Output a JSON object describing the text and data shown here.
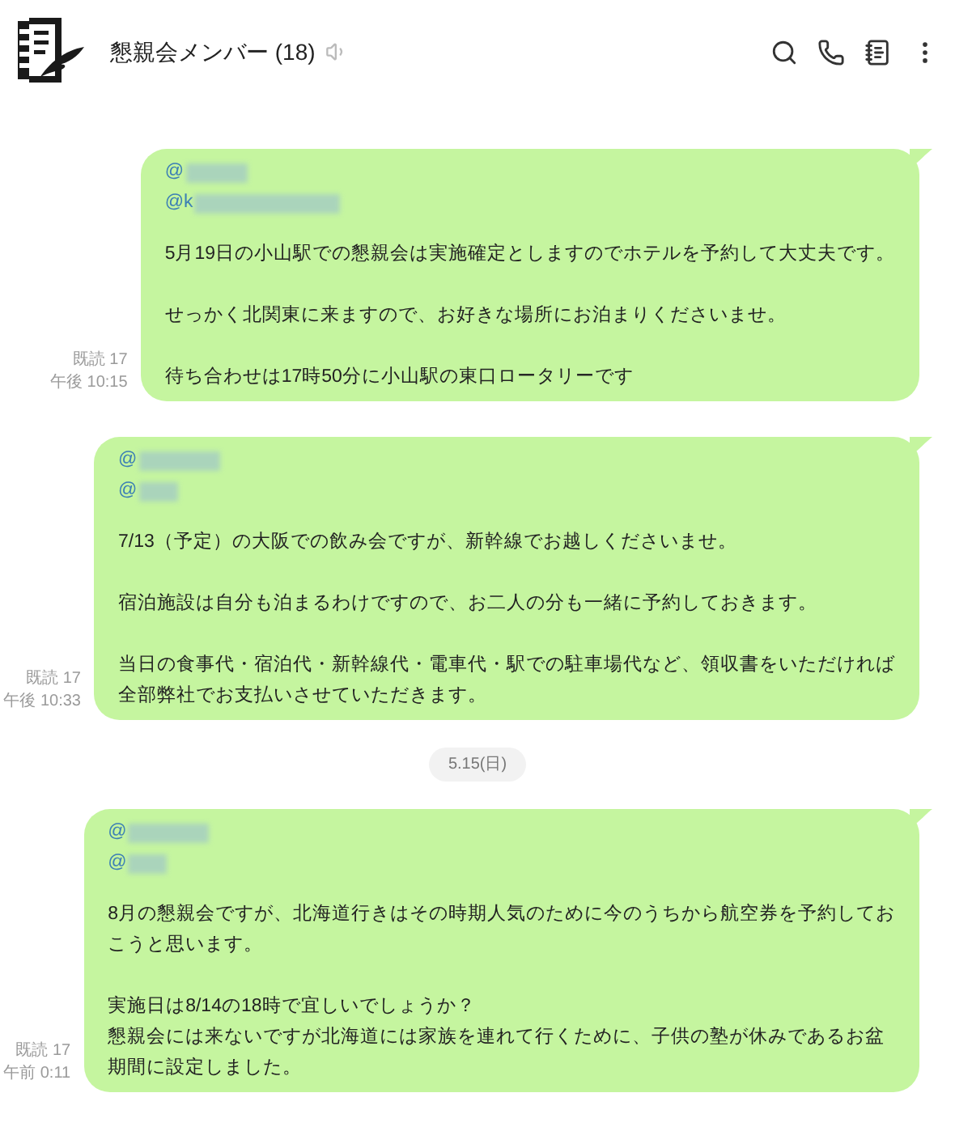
{
  "header": {
    "title": "懇親会メンバー (18)"
  },
  "timeline": [
    {
      "kind": "message",
      "read": "既読 17",
      "time": "午後 10:15",
      "mentions": [
        "@",
        "@k"
      ],
      "paragraphs": [
        [
          "5月19日の小山駅での懇親会は実施確定としますのでホテルを予約して大丈夫です。"
        ],
        [
          "せっかく北関東に来ますので、お好きな場所にお泊まりくださいませ。"
        ],
        [
          "待ち合わせは17時50分に小山駅の東口ロータリーです"
        ]
      ]
    },
    {
      "kind": "message",
      "read": "既読 17",
      "time": "午後 10:33",
      "mentions": [
        "@",
        "@"
      ],
      "paragraphs": [
        [
          "7/13（予定）の大阪での飲み会ですが、新幹線でお越しくださいませ。"
        ],
        [
          "宿泊施設は自分も泊まるわけですので、お二人の分も一緒に予約しておきます。"
        ],
        [
          "当日の食事代・宿泊代・新幹線代・電車代・駅での駐車場代など、領収書をいただければ",
          "全部弊社でお支払いさせていただきます。"
        ]
      ]
    },
    {
      "kind": "date",
      "label": "5.15(日)"
    },
    {
      "kind": "message",
      "read": "既読 17",
      "time": "午前 0:11",
      "mentions": [
        "@",
        "@"
      ],
      "paragraphs": [
        [
          "8月の懇親会ですが、北海道行きはその時期人気のために今のうちから航空券を予約してお",
          "こうと思います。"
        ],
        [
          "実施日は8/14の18時で宜しいでしょうか？",
          "懇親会には来ないですが北海道には家族を連れて行くために、子供の塾が休みであるお盆",
          "期間に設定しました。"
        ]
      ]
    }
  ]
}
